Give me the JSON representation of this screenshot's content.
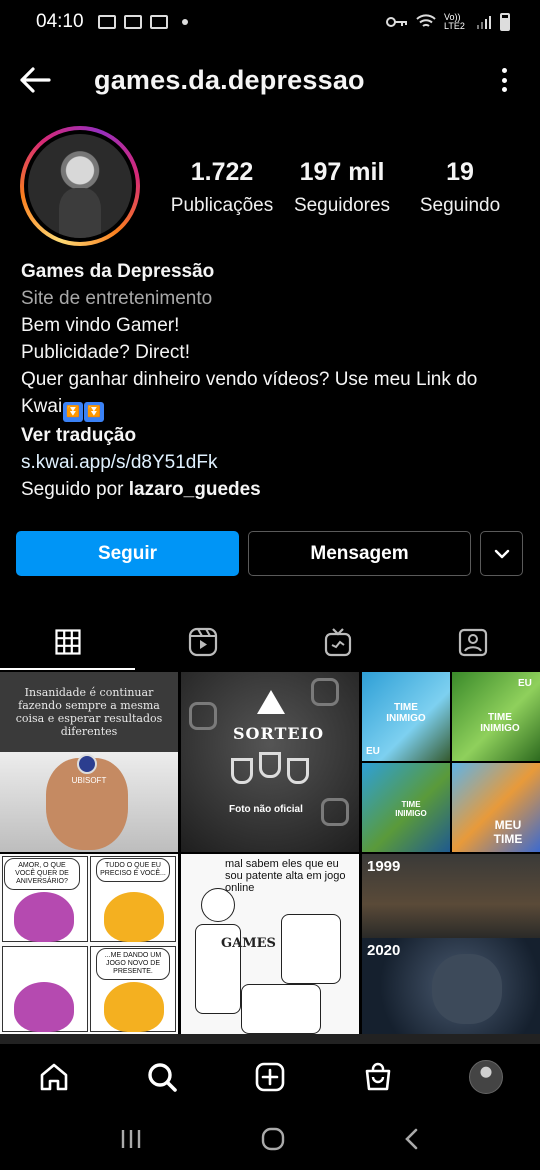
{
  "status_bar": {
    "time": "04:10",
    "network": "Vo)) LTE2",
    "icons": [
      "gallery-icon",
      "game-icon",
      "screenshot-icon",
      "dot-icon",
      "key-icon",
      "wifi-icon",
      "signal-icon",
      "battery-icon"
    ]
  },
  "header": {
    "username": "games.da.depressao",
    "back_icon": "arrow-left-icon",
    "more_icon": "more-vertical-icon"
  },
  "stats": [
    {
      "value": "1.722",
      "label": "Publicações"
    },
    {
      "value": "197 mil",
      "label": "Seguidores"
    },
    {
      "value": "19",
      "label": "Seguindo"
    }
  ],
  "bio": {
    "name": "Games da Depressão",
    "category": "Site de entretenimento",
    "lines": [
      "Bem vindo Gamer!",
      "Publicidade? Direct!",
      "Quer ganhar dinheiro vendo vídeos? Use meu Link do"
    ],
    "line_kwai": "Kwai",
    "translate": "Ver tradução",
    "link": "s.kwai.app/s/d8Y51dFk",
    "followed_by_prefix": "Seguido por ",
    "followed_by_user": "lazaro_guedes"
  },
  "buttons": {
    "follow": "Seguir",
    "message": "Mensagem"
  },
  "tabs": [
    "grid-icon",
    "reels-icon",
    "igtv-icon",
    "tagged-icon"
  ],
  "grid": {
    "post1_quote": "Insanidade é continuar fazendo sempre a mesma coisa e esperar resultados diferentes",
    "post1_logo": "UBISOFT",
    "post2_title": "SORTEIO",
    "post2_footer": "Foto não oficial",
    "post3_labels": [
      "TIME INIMIGO",
      "EU",
      "TIME INIMIGO",
      "EU",
      "TIME INIMIGO",
      "MEU TIME"
    ],
    "post4_bubbles": [
      "AMOR, O QUE VOCÊ QUER DE ANIVERSÁRIO?",
      "TUDO O QUE EU PRECISO É VOCÊ...",
      "...ME DANDO UM JOGO NOVO DE PRESENTE."
    ],
    "post5_caption": "mal sabem eles que eu sou patente alta em jogo online",
    "post5_watermark": "GAMES",
    "post6_years": [
      "1999",
      "2020"
    ]
  },
  "bottom_nav": [
    "home-icon",
    "search-icon",
    "add-post-icon",
    "shop-icon",
    "profile-avatar"
  ],
  "colors": {
    "follow_button": "#0095f6",
    "background": "#000000"
  }
}
